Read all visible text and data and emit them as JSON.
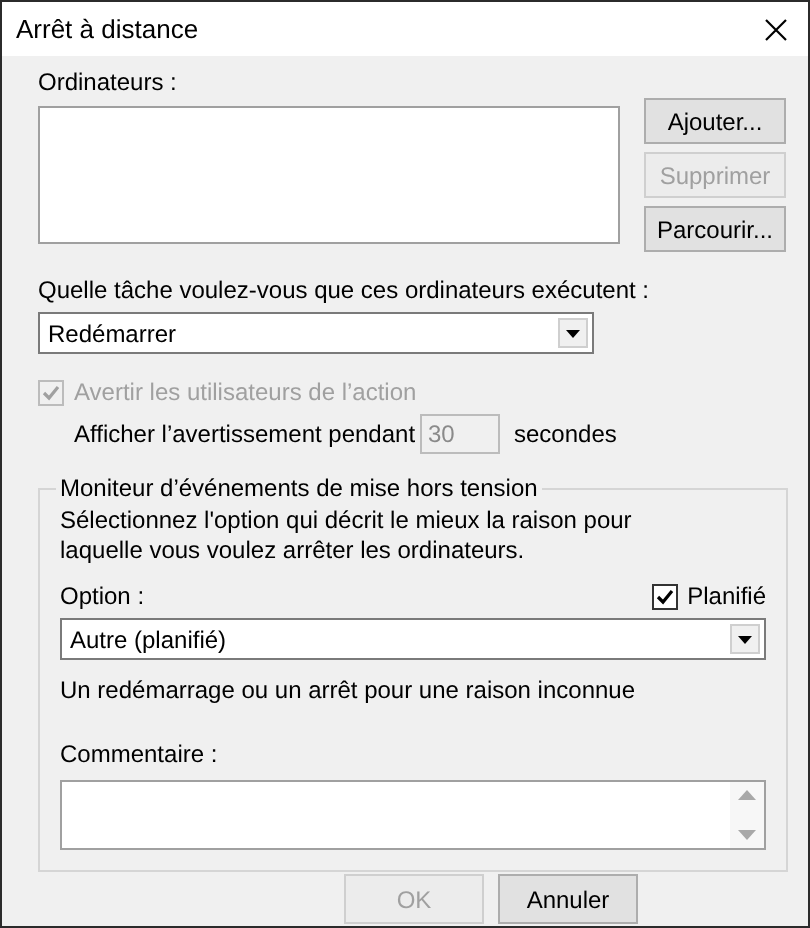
{
  "window": {
    "title": "Arrêt à distance"
  },
  "computers": {
    "label": "Ordinateurs :"
  },
  "side_buttons": [
    {
      "label": "Ajouter...",
      "disabled": false
    },
    {
      "label": "Supprimer",
      "disabled": true
    },
    {
      "label": "Parcourir...",
      "disabled": false
    }
  ],
  "task": {
    "label": "Quelle tâche voulez-vous que ces ordinateurs exécutent :",
    "value": "Redémarrer"
  },
  "warn": {
    "label": "Avertir les utilisateurs de l’action",
    "checked": true,
    "disabled": true
  },
  "warn_time": {
    "label": "Afficher l’avertissement pendant",
    "value": "30",
    "unit": "secondes",
    "disabled": true
  },
  "event_tracker": {
    "legend": "Moniteur d’événements de mise hors tension",
    "description": "Sélectionnez l'option qui décrit le mieux la raison pour laquelle vous voulez arrêter les ordinateurs.",
    "option_label": "Option :",
    "planned": {
      "label": "Planifié",
      "checked": true,
      "disabled": false
    },
    "option_value": "Autre (planifié)",
    "reason": "Un redémarrage ou un arrêt pour une raison inconnue",
    "comment_label": "Commentaire :"
  },
  "footer_buttons": [
    {
      "label": "OK",
      "disabled": true
    },
    {
      "label": "Annuler",
      "disabled": false
    }
  ]
}
